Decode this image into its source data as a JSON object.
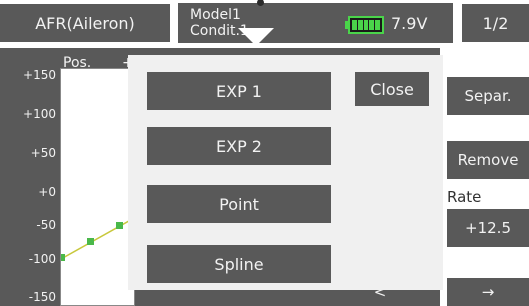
{
  "header": {
    "title": "AFR(Aileron)",
    "model_name": "Model1",
    "condition": "Condit.1",
    "voltage": "7.9V",
    "page": "1/2"
  },
  "graph": {
    "pos_label": "Pos.",
    "plus_label": "+",
    "y_ticks": [
      "+150",
      "+100",
      "+50",
      "+0",
      "-50",
      "-100",
      "-150"
    ]
  },
  "side": {
    "separ_label": "Separ.",
    "remove_label": "Remove",
    "rate_label": "Rate",
    "rate_value": "+12.5",
    "bottom_left_label": "<",
    "bottom_right_label": "→"
  },
  "menu": {
    "exp1_label": "EXP 1",
    "exp2_label": "EXP 2",
    "point_label": "Point",
    "spline_label": "Spline",
    "close_label": "Close"
  },
  "colors": {
    "button_bg": "#595959",
    "button_text": "#f2f2f2",
    "battery": "#4ad44a",
    "curve": "#c8c83c",
    "curve_point": "#4ab84a"
  }
}
